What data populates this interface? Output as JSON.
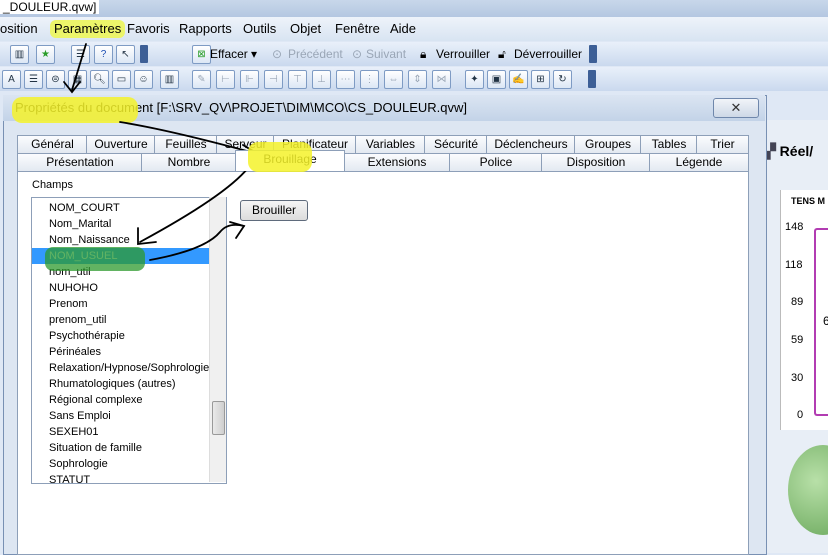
{
  "window_title": "_DOULEUR.qvw]",
  "menu": [
    "osition",
    "Paramètres",
    "Favoris",
    "Rapports",
    "Outils",
    "Objet",
    "Fenêtre",
    "Aide"
  ],
  "toolbar": {
    "effacer": "Effacer",
    "precedent": "Précédent",
    "suivant": "Suivant",
    "verrouiller": "Verrouiller",
    "deverrouiller": "Déverrouiller"
  },
  "background": {
    "reel_tab": "Réel/",
    "chart_title": "TENS M",
    "y_ticks": [
      "148",
      "118",
      "89",
      "59",
      "30",
      "0"
    ],
    "partial_digit": "6"
  },
  "dialog": {
    "title": "Propriétés du document [F:\\SRV_QV\\PROJET\\DIM\\MCO\\CS_DOULEUR.qvw]",
    "tabs_row1": [
      "Général",
      "Ouverture",
      "Feuilles",
      "Serveur",
      "Planificateur",
      "Variables",
      "Sécurité",
      "Déclencheurs",
      "Groupes",
      "Tables",
      "Trier"
    ],
    "tabs_row2": [
      "Présentation",
      "Nombre",
      "Brouillage",
      "Extensions",
      "Police",
      "Disposition",
      "Légende"
    ],
    "active_tab": "Brouillage",
    "champs_label": "Champs",
    "fields": [
      "NOM_COURT",
      "Nom_Marital",
      "Nom_Naissance",
      "NOM_USUEL",
      "nom_util",
      "NUHOHO",
      "Prenom",
      "prenom_util",
      "Psychothérapie",
      "Périnéales",
      "Relaxation/Hypnose/Sophrologie",
      "Rhumatologiques (autres)",
      "Régional complexe",
      "Sans Emploi",
      "SEXEH01",
      "Situation de famille",
      "Sophrologie",
      "STATUT"
    ],
    "selected_field": "NOM_USUEL",
    "button_brouiller": "Brouiller"
  },
  "colors": {
    "highlight": "#f4f22a",
    "selection": "#3399ff",
    "dialog_bg": "#dde6f2"
  }
}
